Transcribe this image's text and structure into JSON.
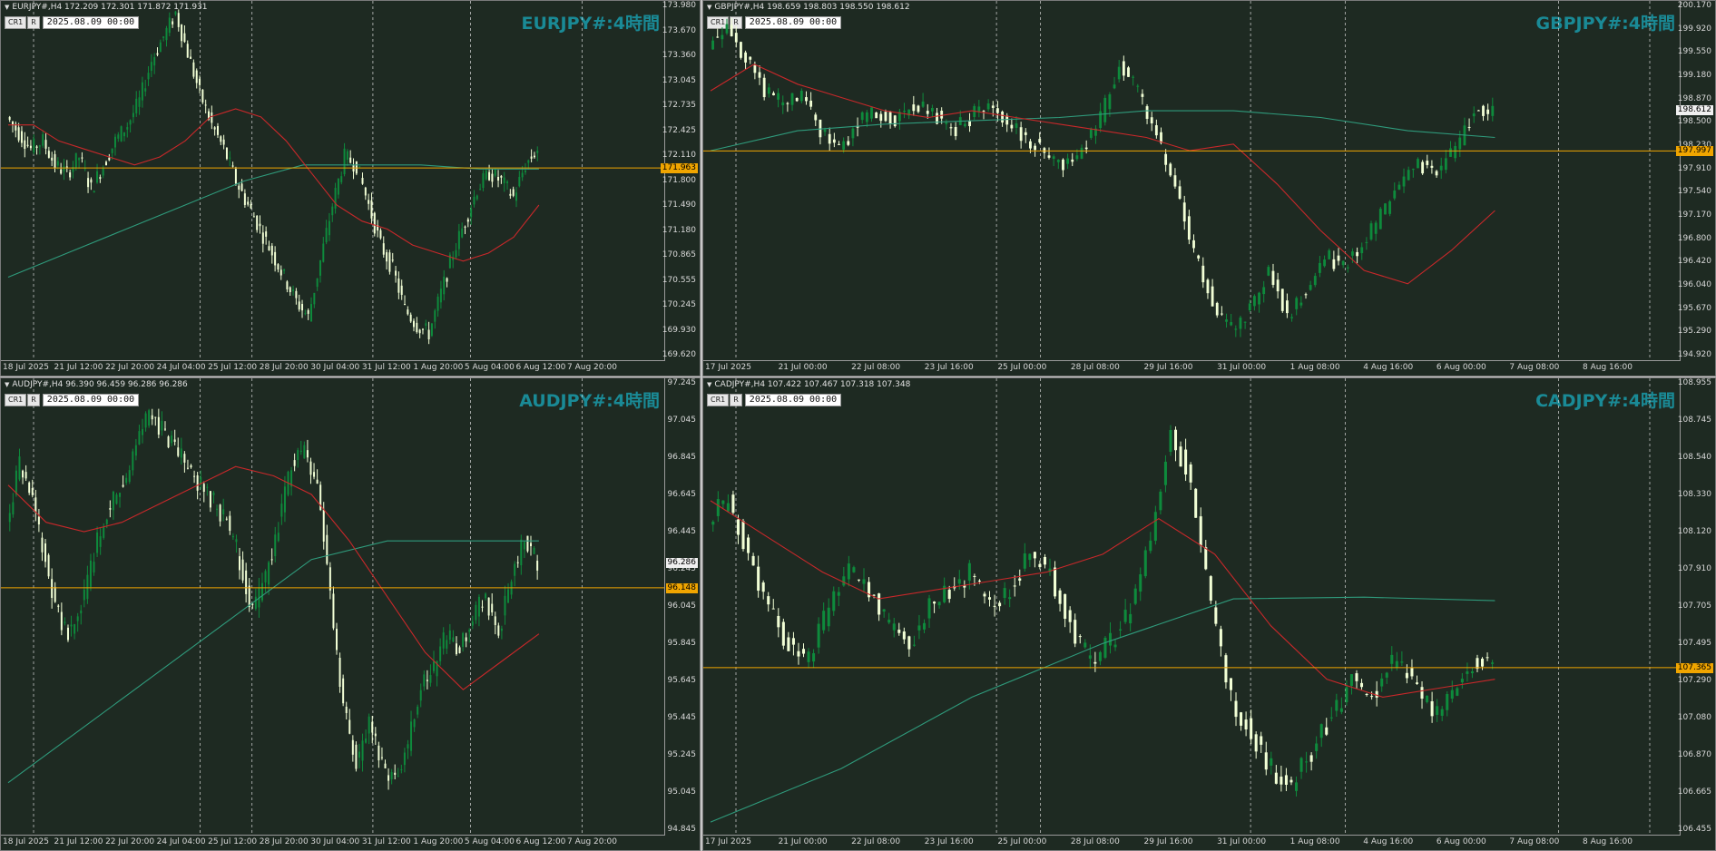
{
  "colors": {
    "bg": "#1e2a22",
    "bull": "#0e8a3c",
    "bear": "#f2ffd6",
    "ma_fast": "#c8282a",
    "ma_slow": "#2f9b7c",
    "hline": "#f0a500",
    "grid": "#d8d8d8"
  },
  "controls": {
    "cr1": "CR1",
    "r": "R",
    "date": "2025.08.09 00:00"
  },
  "panels": [
    {
      "id": "eurjpy",
      "header": "EURJPY#,H4  172.209 172.301 171.872 171.931",
      "title": "EURJPY#:4時間",
      "y_ticks": [
        "173.980",
        "173.670",
        "173.360",
        "173.045",
        "172.735",
        "172.425",
        "172.110",
        "171.800",
        "171.490",
        "171.180",
        "170.865",
        "170.555",
        "170.245",
        "169.930",
        "169.620"
      ],
      "x_ticks": [
        "18 Jul 2025",
        "21 Jul 12:00",
        "22 Jul 20:00",
        "24 Jul 04:00",
        "25 Jul 12:00",
        "28 Jul 20:00",
        "30 Jul 04:00",
        "31 Jul 12:00",
        "1 Aug 20:00",
        "5 Aug 04:00",
        "6 Aug 12:00",
        "7 Aug 20:00"
      ],
      "tags": [
        {
          "text": "171.963",
          "style": "orange"
        }
      ]
    },
    {
      "id": "gbpjpy",
      "header": "GBPJPY#,H4  198.659 198.803 198.550 198.612",
      "title": "GBPJPY#:4時間",
      "y_ticks": [
        "200.170",
        "199.920",
        "199.550",
        "199.180",
        "198.870",
        "198.500",
        "198.230",
        "197.910",
        "197.540",
        "197.170",
        "196.800",
        "196.420",
        "196.040",
        "195.670",
        "195.290",
        "194.920"
      ],
      "x_ticks": [
        "17 Jul 2025",
        "21 Jul 00:00",
        "22 Jul 08:00",
        "23 Jul 16:00",
        "25 Jul 00:00",
        "28 Jul 08:00",
        "29 Jul 16:00",
        "31 Jul 00:00",
        "1 Aug 08:00",
        "4 Aug 16:00",
        "6 Aug 00:00",
        "7 Aug 08:00",
        "8 Aug 16:00"
      ],
      "tags": [
        {
          "text": "198.612",
          "style": "white"
        },
        {
          "text": "197.997",
          "style": "orange"
        }
      ]
    },
    {
      "id": "audjpy",
      "header": "AUDJPY#,H4  96.390 96.459 96.286 96.286",
      "title": "AUDJPY#:4時間",
      "y_ticks": [
        "97.245",
        "97.045",
        "96.845",
        "96.645",
        "96.445",
        "96.245",
        "96.045",
        "95.845",
        "95.645",
        "95.445",
        "95.245",
        "95.045",
        "94.845"
      ],
      "x_ticks": [
        "18 Jul 2025",
        "21 Jul 12:00",
        "22 Jul 20:00",
        "24 Jul 04:00",
        "25 Jul 12:00",
        "28 Jul 20:00",
        "30 Jul 04:00",
        "31 Jul 12:00",
        "1 Aug 20:00",
        "5 Aug 04:00",
        "6 Aug 12:00",
        "7 Aug 20:00"
      ],
      "tags": [
        {
          "text": "96.286",
          "style": "white"
        },
        {
          "text": "96.148",
          "style": "orange"
        }
      ]
    },
    {
      "id": "cadjpy",
      "header": "CADJPY#,H4  107.422 107.467 107.318 107.348",
      "title": "CADJPY#:4時間",
      "y_ticks": [
        "108.955",
        "108.745",
        "108.540",
        "108.330",
        "108.120",
        "107.910",
        "107.705",
        "107.495",
        "107.290",
        "107.080",
        "106.870",
        "106.665",
        "106.455"
      ],
      "x_ticks": [
        "17 Jul 2025",
        "21 Jul 00:00",
        "22 Jul 08:00",
        "23 Jul 16:00",
        "25 Jul 00:00",
        "28 Jul 08:00",
        "29 Jul 16:00",
        "31 Jul 00:00",
        "1 Aug 08:00",
        "4 Aug 16:00",
        "6 Aug 00:00",
        "7 Aug 08:00",
        "8 Aug 16:00"
      ],
      "tags": [
        {
          "text": "107.365",
          "style": "orange"
        }
      ]
    }
  ],
  "chart_data": [
    {
      "type": "candlestick",
      "title": "EURJPY#:4時間",
      "ylim": [
        169.62,
        173.98
      ],
      "hline": 171.963,
      "path": [
        172.6,
        172.4,
        172.2,
        172.3,
        172.0,
        171.9,
        172.1,
        171.7,
        172.0,
        172.3,
        172.5,
        172.8,
        173.3,
        173.6,
        173.9,
        173.4,
        172.9,
        172.5,
        172.2,
        171.8,
        171.5,
        171.2,
        170.9,
        170.6,
        170.3,
        170.1,
        170.8,
        171.5,
        172.1,
        172.0,
        171.5,
        171.0,
        170.7,
        170.2,
        170.0,
        169.9,
        170.4,
        170.9,
        171.3,
        171.7,
        171.9,
        171.8,
        171.6,
        172.0,
        172.2
      ],
      "ma_fast": [
        172.5,
        172.5,
        172.3,
        172.2,
        172.1,
        172.0,
        172.1,
        172.3,
        172.6,
        172.7,
        172.6,
        172.3,
        171.9,
        171.5,
        171.3,
        171.2,
        171.0,
        170.9,
        170.8,
        170.9,
        171.1,
        171.5
      ],
      "ma_slow": [
        170.6,
        170.9,
        171.2,
        171.5,
        171.8,
        172.0,
        172.0,
        172.0,
        171.95,
        171.95
      ]
    },
    {
      "type": "candlestick",
      "title": "GBPJPY#:4時間",
      "ylim": [
        194.92,
        200.17
      ],
      "hline": 197.997,
      "path": [
        199.6,
        199.9,
        199.4,
        198.9,
        198.7,
        198.8,
        198.3,
        198.0,
        198.4,
        198.6,
        198.5,
        198.7,
        198.6,
        198.3,
        198.5,
        198.7,
        198.4,
        198.2,
        198.0,
        197.8,
        198.0,
        198.5,
        199.3,
        198.9,
        198.2,
        197.4,
        196.5,
        195.7,
        195.3,
        195.6,
        196.2,
        195.5,
        195.9,
        196.4,
        196.3,
        196.6,
        197.0,
        197.5,
        197.8,
        197.7,
        198.0,
        198.6,
        198.6
      ],
      "ma_fast": [
        198.9,
        199.3,
        199.0,
        198.8,
        198.6,
        198.5,
        198.6,
        198.5,
        198.4,
        198.3,
        198.2,
        198.0,
        198.1,
        197.5,
        196.8,
        196.2,
        196.0,
        196.5,
        197.1
      ],
      "ma_slow": [
        198.0,
        198.3,
        198.4,
        198.45,
        198.5,
        198.6,
        198.6,
        198.5,
        198.3,
        198.2
      ]
    },
    {
      "type": "candlestick",
      "title": "AUDJPY#:4時間",
      "ylim": [
        94.845,
        97.245
      ],
      "hline": 96.148,
      "path": [
        96.5,
        96.8,
        96.6,
        96.3,
        96.0,
        95.9,
        96.1,
        96.4,
        96.6,
        96.7,
        96.9,
        97.1,
        97.0,
        96.9,
        96.8,
        96.7,
        96.6,
        96.5,
        96.3,
        96.0,
        96.2,
        96.5,
        96.8,
        96.9,
        96.7,
        96.1,
        95.5,
        95.2,
        95.4,
        95.2,
        95.1,
        95.3,
        95.6,
        95.7,
        95.9,
        95.8,
        96.0,
        96.1,
        95.9,
        96.2,
        96.4,
        96.3
      ],
      "ma_fast": [
        96.7,
        96.5,
        96.45,
        96.5,
        96.6,
        96.7,
        96.8,
        96.75,
        96.65,
        96.4,
        96.1,
        95.8,
        95.6,
        95.75,
        95.9
      ],
      "ma_slow": [
        95.1,
        95.4,
        95.7,
        96.0,
        96.3,
        96.4,
        96.4,
        96.4
      ]
    },
    {
      "type": "candlestick",
      "title": "CADJPY#:4時間",
      "ylim": [
        106.455,
        108.955
      ],
      "hline": 107.365,
      "path": [
        108.2,
        108.3,
        108.0,
        107.7,
        107.5,
        107.4,
        107.7,
        107.9,
        107.8,
        107.6,
        107.5,
        107.7,
        107.8,
        107.9,
        107.7,
        107.8,
        108.0,
        107.9,
        107.6,
        107.4,
        107.5,
        107.7,
        108.1,
        108.7,
        108.4,
        107.7,
        107.2,
        107.0,
        106.8,
        106.7,
        106.9,
        107.1,
        107.3,
        107.2,
        107.4,
        107.3,
        107.1,
        107.2,
        107.4,
        107.4
      ],
      "ma_fast": [
        108.3,
        108.1,
        107.9,
        107.75,
        107.8,
        107.85,
        107.9,
        108.0,
        108.2,
        108.0,
        107.6,
        107.3,
        107.2,
        107.25,
        107.3
      ],
      "ma_slow": [
        106.5,
        106.8,
        107.2,
        107.5,
        107.75,
        107.76,
        107.74
      ]
    }
  ]
}
